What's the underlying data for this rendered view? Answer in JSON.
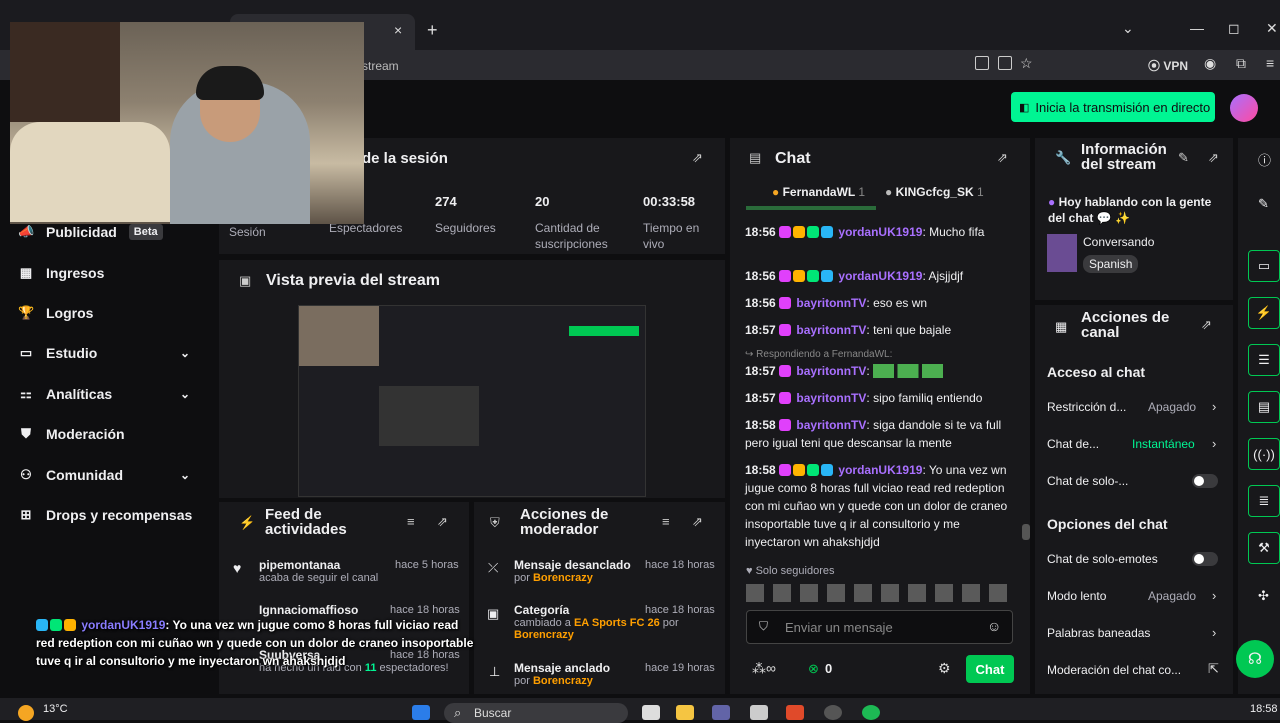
{
  "browser": {
    "tab_close": "×",
    "new_tab": "+",
    "address_fragment": "stream",
    "vpn": "VPN",
    "min": "—",
    "max": "◻",
    "close": "✕",
    "dropdown": "⌄"
  },
  "topbar": {
    "go_live": "Inicia la transmisión en directo"
  },
  "sidebar": {
    "items": [
      {
        "label": "Publicidad",
        "badge": "Beta",
        "icon": "megaphone-icon"
      },
      {
        "label": "Ingresos",
        "icon": "chart-icon"
      },
      {
        "label": "Logros",
        "icon": "trophy-icon"
      },
      {
        "label": "Estudio",
        "icon": "studio-icon",
        "expandable": true
      },
      {
        "label": "Analíticas",
        "icon": "analytics-icon",
        "expandable": true
      },
      {
        "label": "Moderación",
        "icon": "shield-icon"
      },
      {
        "label": "Comunidad",
        "icon": "people-icon",
        "expandable": true
      },
      {
        "label": "Drops y recompensas",
        "icon": "gift-icon"
      }
    ]
  },
  "session": {
    "title": "de la sesión",
    "stats": [
      {
        "value": "",
        "label": "Sesión"
      },
      {
        "value": "",
        "label": "Espectadores"
      },
      {
        "value": "274",
        "label": "Seguidores"
      },
      {
        "value": "20",
        "label": "Cantidad de suscripciones"
      },
      {
        "value": "00:33:58",
        "label": "Tiempo en vivo"
      }
    ]
  },
  "preview": {
    "title": "Vista previa del stream"
  },
  "activity": {
    "title": "Feed de actividades",
    "items": [
      {
        "name": "pipemontanaa",
        "sub": "acaba de seguir el canal",
        "time": "hace 5 horas"
      },
      {
        "name": "Ignnaciomaffioso",
        "sub": "",
        "time": "hace 18 horas"
      },
      {
        "name": "Suubversa",
        "sub": "ha hecho un raid con",
        "count": "11",
        "sub2": "espectadores!",
        "time": "hace 18 horas"
      }
    ]
  },
  "mod_actions": {
    "title": "Acciones de moderador",
    "items": [
      {
        "name": "Mensaje desanclado",
        "by": "por",
        "user": "Borencrazy",
        "time": "hace 18 horas"
      },
      {
        "name": "Categoría",
        "sub": "cambiado a",
        "game": "EA Sports FC 26",
        "by": "por",
        "user": "Borencrazy",
        "time": "hace 18 horas"
      },
      {
        "name": "Mensaje anclado",
        "by": "por",
        "user": "Borencrazy",
        "time": "hace 19 horas"
      }
    ]
  },
  "chat": {
    "title": "Chat",
    "top_chatters": [
      {
        "name": "FernandaWL",
        "rank": "1"
      },
      {
        "name": "KINGcfcg_SK",
        "rank": "1"
      }
    ],
    "messages": [
      {
        "time": "18:56",
        "user": "yordanUK1919",
        "text": "Mucho fifa",
        "color": "#a970ff"
      },
      {
        "time": "18:56",
        "user": "yordanUK1919",
        "text": "Ajsjjdjf",
        "color": "#a970ff"
      },
      {
        "time": "18:56",
        "user": "bayritonnTV",
        "text": "eso es wn",
        "color": "#1e90ff"
      },
      {
        "time": "18:57",
        "user": "bayritonnTV",
        "text": "teni que bajale",
        "color": "#1e90ff"
      },
      {
        "time": "18:57",
        "user": "bayritonnTV",
        "text": "",
        "reply": "Respondiendo a FernandaWL:",
        "color": "#1e90ff"
      },
      {
        "time": "18:57",
        "user": "bayritonnTV",
        "text": "sipo familiq entiendo",
        "color": "#1e90ff"
      },
      {
        "time": "18:58",
        "user": "bayritonnTV",
        "text": "siga dandole si te va full pero igual teni que descansar la mente",
        "color": "#1e90ff"
      },
      {
        "time": "18:58",
        "user": "yordanUK1919",
        "text": "Yo una vez wn jugue como 8 horas full viciao read red redeption con mi cuñao wn y quede con un dolor de craneo insoportable tuve q ir al consultorio y me inyectaron wn ahakshjdjd",
        "color": "#a970ff"
      }
    ],
    "followers_only": "Solo seguidores",
    "input_placeholder": "Enviar un mensaje",
    "points": "0",
    "send": "Chat"
  },
  "stream_info": {
    "title": "Información del stream",
    "headline": "Hoy hablando con la gente del chat 💬 ✨",
    "category": "Conversando",
    "language": "Spanish"
  },
  "channel_actions": {
    "title": "Acciones de canal",
    "chat_access": "Acceso al chat",
    "rows1": [
      {
        "label": "Restricción d...",
        "value": "Apagado",
        "type": "chevron"
      },
      {
        "label": "Chat de...",
        "value": "Instantáneo",
        "type": "chevron",
        "accent": true
      },
      {
        "label": "Chat de solo-...",
        "type": "toggle"
      }
    ],
    "chat_options": "Opciones del chat",
    "rows2": [
      {
        "label": "Chat de solo-emotes",
        "type": "toggle"
      },
      {
        "label": "Modo lento",
        "value": "Apagado",
        "type": "chevron"
      },
      {
        "label": "Palabras baneadas",
        "type": "chevron"
      },
      {
        "label": "Moderación del chat co...",
        "type": "external"
      }
    ]
  },
  "overlay": {
    "user": "yordanUK1919",
    "text": ": Yo una vez wn jugue como 8 horas full viciao read red redeption con mi cuñao wn y quede con un dolor de craneo insoportable tuve q ir al consultorio y me inyectaron wn ahakshjdjd"
  },
  "taskbar": {
    "weather": "13°C",
    "search": "Buscar",
    "clock": "18:58"
  },
  "colors": {
    "accent": "#00f593",
    "chat_button": "#00c853",
    "username_purple": "#a970ff",
    "username_blue": "#1e90ff"
  }
}
